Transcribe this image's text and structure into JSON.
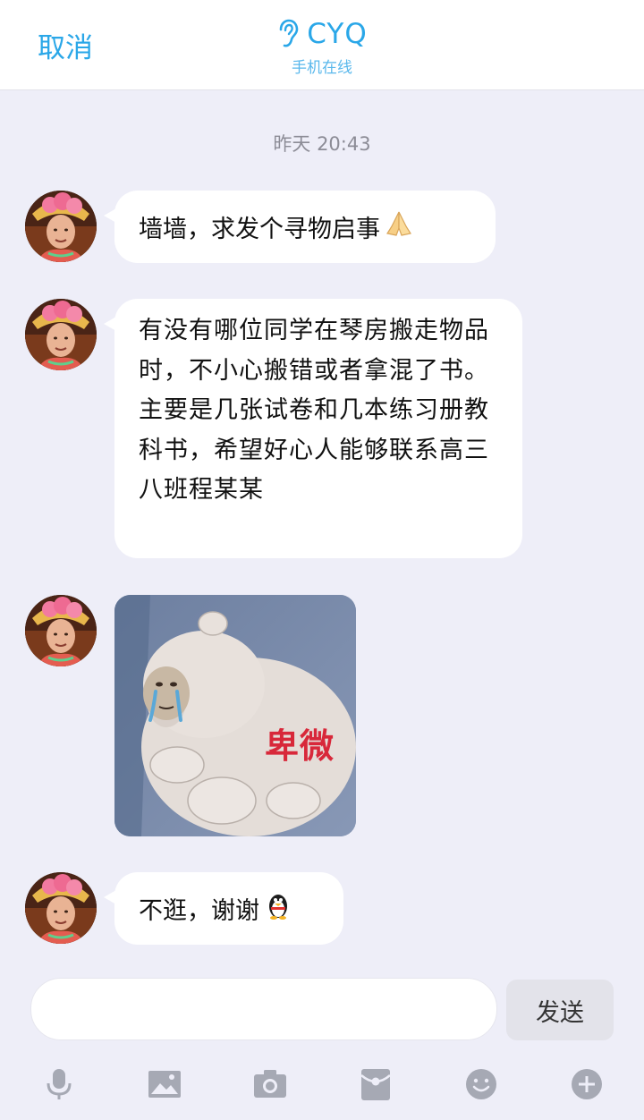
{
  "header": {
    "cancel_label": "取消",
    "contact_name": "CYQ",
    "status": "手机在线"
  },
  "timestamp": "昨天 20:43",
  "messages": [
    {
      "type": "text",
      "text": "墙墙，求发个寻物启事",
      "emoji": "folded-hands-emoji"
    },
    {
      "type": "text",
      "text": "有没有哪位同学在琴房搬走物品时，不小心搬错或者拿混了书。主要是几张试卷和几本练习册教科书，希望好心人能够联系高三八班程某某"
    },
    {
      "type": "sticker",
      "caption": "卑微",
      "image": "crying-bear-meme"
    },
    {
      "type": "text",
      "text": "不逛，谢谢",
      "emoji": "qq-penguin-emoji"
    }
  ],
  "input": {
    "placeholder": "",
    "value": ""
  },
  "send_label": "发送",
  "toolbar": [
    "microphone-icon",
    "image-icon",
    "camera-icon",
    "red-packet-icon",
    "emoji-icon",
    "plus-icon"
  ],
  "colors": {
    "accent": "#2aa7e8",
    "background": "#eeeef8",
    "bubble": "#ffffff"
  }
}
